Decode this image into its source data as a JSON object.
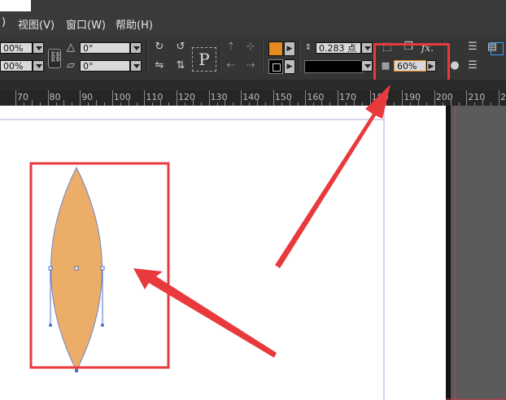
{
  "menu": {
    "items": [
      ")",
      "视图(V)",
      "窗口(W)",
      "帮助(H)"
    ]
  },
  "toolbar": {
    "scale_x": "00%",
    "scale_y": "00%",
    "rotate": "0°",
    "shear": "0°",
    "stroke_weight": "0.283 点",
    "opacity": "60%",
    "fill_color": "#e48a1f",
    "stroke_color": "#000000",
    "fx_label": "fx."
  },
  "ruler": {
    "ticks": [
      "70",
      "80",
      "90",
      "100",
      "110",
      "120",
      "130",
      "140",
      "150",
      "160",
      "170",
      "180",
      "190",
      "200",
      "210",
      "220"
    ]
  },
  "shape": {
    "fill_color": "#ecad68"
  },
  "annotation": {
    "color": "#e8393c"
  }
}
